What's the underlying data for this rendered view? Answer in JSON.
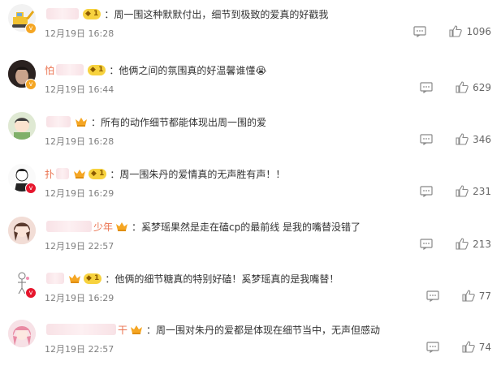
{
  "comments": [
    {
      "name_prefix": "",
      "name_suffix": "",
      "has_crown": false,
      "level": "1",
      "text": "周一围这种默默付出，细节到极致的爱真的好戳我",
      "time": "12月19日 16:28",
      "likes": "1096",
      "badge_color": "#f5a623",
      "avatar_icon": "excavator-avatar"
    },
    {
      "name_prefix": "怕",
      "name_suffix": "",
      "has_crown": false,
      "level": "1",
      "text": "他俩之间的氛围真的好温馨谁懂😭",
      "time": "12月19日 16:44",
      "likes": "629",
      "badge_color": "#f5a623",
      "avatar_icon": "dark-portrait-avatar"
    },
    {
      "name_prefix": "",
      "name_suffix": "",
      "has_crown": true,
      "level": "",
      "text": "所有的动作细节都能体现出周一围的爱",
      "time": "12月19日 16:28",
      "likes": "346",
      "badge_color": "",
      "avatar_icon": "cartoon-avatar"
    },
    {
      "name_prefix": "扑",
      "name_suffix": "",
      "has_crown": true,
      "level": "1",
      "text": "周一围朱丹的爱情真的无声胜有声！！",
      "time": "12月19日 16:29",
      "likes": "231",
      "badge_color": "#e6162d",
      "avatar_icon": "boy-sketch-avatar"
    },
    {
      "name_prefix": "",
      "name_suffix": "少年",
      "has_crown": true,
      "level": "",
      "text": "奚梦瑶果然是走在磕cp的最前线 是我的嘴替没错了",
      "time": "12月19日 22:57",
      "likes": "213",
      "badge_color": "",
      "avatar_icon": "girl-portrait-avatar"
    },
    {
      "name_prefix": "",
      "name_suffix": "",
      "has_crown": true,
      "level": "1",
      "text": "他俩的细节糖真的特别好磕！奚梦瑶真的是我嘴替！",
      "time": "12月19日 16:29",
      "likes": "77",
      "badge_color": "#e6162d",
      "avatar_icon": "figure-sketch-avatar"
    },
    {
      "name_prefix": "",
      "name_suffix": "干",
      "has_crown": true,
      "level": "",
      "text": "周一围对朱丹的爱都是体现在细节当中，无声但感动",
      "time": "12月19日 22:57",
      "likes": "74",
      "badge_color": "",
      "avatar_icon": "pink-hair-avatar"
    }
  ]
}
